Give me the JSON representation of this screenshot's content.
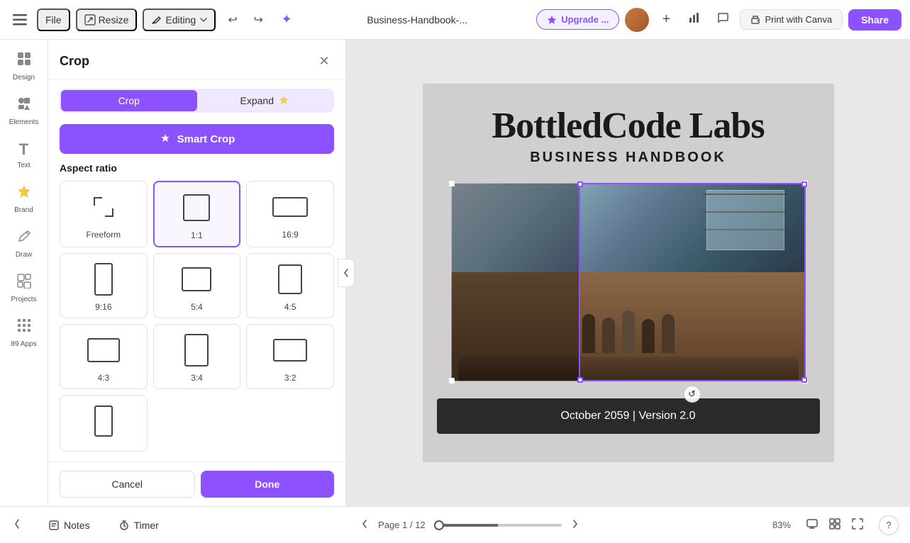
{
  "topbar": {
    "file_label": "File",
    "resize_label": "Resize",
    "editing_label": "Editing",
    "doc_title": "Business-Handbook-...",
    "upgrade_label": "Upgrade ...",
    "print_label": "Print with Canva",
    "share_label": "Share"
  },
  "panel": {
    "title": "Crop",
    "crop_label": "Crop",
    "expand_label": "Expand",
    "smart_crop_label": "Smart Crop",
    "aspect_ratio_label": "Aspect ratio",
    "aspect_options": [
      {
        "id": "freeform",
        "label": "Freeform",
        "selected": false
      },
      {
        "id": "1-1",
        "label": "1:1",
        "selected": true
      },
      {
        "id": "16-9",
        "label": "16:9",
        "selected": false
      },
      {
        "id": "9-16",
        "label": "9:16",
        "selected": false
      },
      {
        "id": "5-4",
        "label": "5:4",
        "selected": false
      },
      {
        "id": "4-5",
        "label": "4:5",
        "selected": false
      },
      {
        "id": "4-3",
        "label": "4:3",
        "selected": false
      },
      {
        "id": "3-4",
        "label": "3:4",
        "selected": false
      },
      {
        "id": "3-2",
        "label": "3:2",
        "selected": false
      }
    ],
    "cancel_label": "Cancel",
    "done_label": "Done"
  },
  "sidebar": {
    "items": [
      {
        "id": "design",
        "label": "Design",
        "icon": "⊞"
      },
      {
        "id": "elements",
        "label": "Elements",
        "icon": "✦"
      },
      {
        "id": "text",
        "label": "Text",
        "icon": "T"
      },
      {
        "id": "brand",
        "label": "Brand",
        "icon": "👑"
      },
      {
        "id": "draw",
        "label": "Draw",
        "icon": "✏"
      },
      {
        "id": "projects",
        "label": "Projects",
        "icon": "▦"
      },
      {
        "id": "apps",
        "label": "89 Apps",
        "icon": "⊞"
      }
    ]
  },
  "canvas": {
    "title": "BottledCode Labs",
    "subtitle": "BUSINESS HANDBOOK",
    "date_text": "October 2059 | Version 2.0"
  },
  "bottombar": {
    "notes_label": "Notes",
    "timer_label": "Timer",
    "page_info": "Page 1 / 12",
    "zoom_level": "83%"
  }
}
